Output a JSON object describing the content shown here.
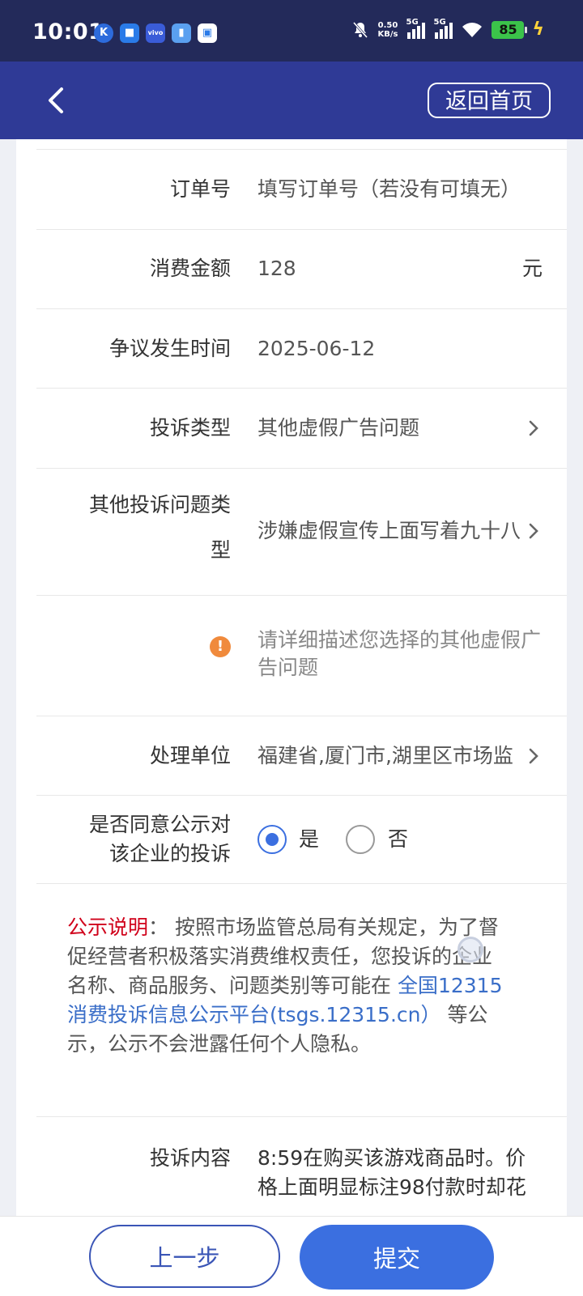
{
  "status_bar": {
    "time": "10:01",
    "apps": [
      "K",
      "■",
      "vivo",
      "▮",
      "▣"
    ],
    "net_speed_value": "0.50",
    "net_speed_unit": "KB/s",
    "sim1": "5G",
    "sim2": "5G",
    "battery": "85"
  },
  "header": {
    "home_label": "返回首页"
  },
  "form": {
    "order": {
      "label": "订单号",
      "value": "填写订单号（若没有可填无）"
    },
    "amount": {
      "label": "消费金额",
      "value": "128",
      "unit": "元"
    },
    "time": {
      "label": "争议发生时间",
      "value": "2025-06-12"
    },
    "type": {
      "label": "投诉类型",
      "value": "其他虚假广告问题"
    },
    "other_type": {
      "label_line1": "其他投诉问题类",
      "label_line2": "型",
      "value": "涉嫌虚假宣传上面写着九十八"
    },
    "other_desc": {
      "text": "请详细描述您选择的其他虚假广告问题"
    },
    "unit": {
      "label": "处理单位",
      "value": "福建省,厦门市,湖里区市场监"
    },
    "public": {
      "label_line1": "是否同意公示对",
      "label_line2": "该企业的投诉",
      "yes": "是",
      "no": "否",
      "selected": "yes"
    },
    "notice": {
      "title": "公示说明",
      "colon": "：",
      "text1": "按照市场监管总局有关规定，为了督促经营者积极落实消费维权责任，您投诉的企业名称、商品服务、问题类别等可能在",
      "link": "全国12315消费投诉信息公示平台(tsgs.12315.cn）",
      "text2": "等公示，公示不会泄露任何个人隐私。"
    },
    "content": {
      "label": "投诉内容",
      "value_line1": "8:59在购买该游戏商品时。价",
      "value_line2": "格上面明显标注98付款时却花"
    }
  },
  "bottom": {
    "prev_label": "上一步",
    "submit_label": "提交"
  },
  "colors": {
    "status_bar": "#232a5a",
    "header": "#2f3a96",
    "primary": "#3b6fe0",
    "warning": "#f08a3c",
    "notice_title": "#d0021b",
    "link": "#3a6ec8"
  }
}
